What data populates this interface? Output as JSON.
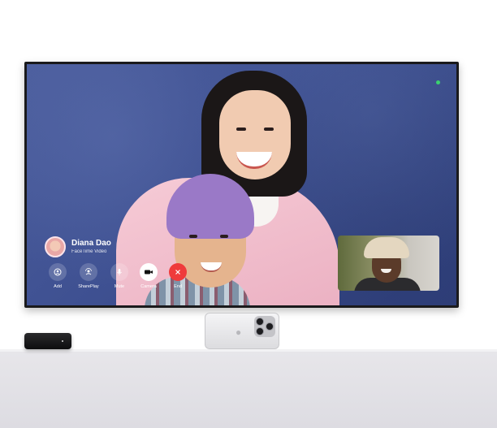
{
  "call": {
    "caller_name": "Diana Dao",
    "caller_subtitle": "FaceTime Video"
  },
  "controls": [
    {
      "label": "Add",
      "icon": "add-person-icon"
    },
    {
      "label": "SharePlay",
      "icon": "shareplay-icon"
    },
    {
      "label": "Mute",
      "icon": "microphone-icon"
    },
    {
      "label": "Camera",
      "icon": "video-camera-icon"
    },
    {
      "label": "End",
      "icon": "close-icon"
    }
  ],
  "colors": {
    "end_button": "#ef3b3b",
    "camera_active": "#ffffff",
    "camera_indicator": "#3bd16f"
  }
}
